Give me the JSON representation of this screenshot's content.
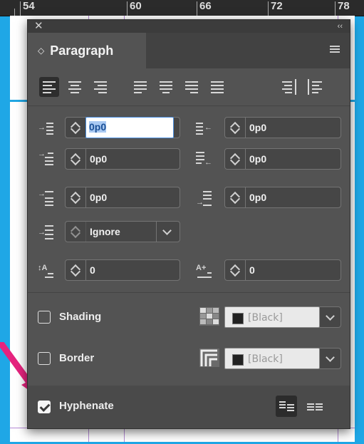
{
  "ruler": {
    "labels": [
      "54",
      "60",
      "66",
      "72",
      "78"
    ]
  },
  "panel": {
    "title": "Paragraph",
    "close_icon": "close-icon",
    "collapse_icon": "collapse-icon",
    "left_indent": "0p0",
    "right_indent": "0p0",
    "first_line_indent": "0p0",
    "last_line_indent": "0p0",
    "space_before": "0p0",
    "space_after": "0p0",
    "align_to_grid": "Ignore",
    "drop_cap_lines": "0",
    "drop_cap_chars": "0",
    "shading": {
      "label": "Shading",
      "checked": false,
      "color": "[Black]"
    },
    "border": {
      "label": "Border",
      "checked": false,
      "color": "[Black]"
    },
    "hyphenate": {
      "label": "Hyphenate",
      "checked": true
    }
  },
  "colors": {
    "highlight_arrow": "#e6237e",
    "panel_bg": "#535353",
    "canvas": "#1fa7e6"
  }
}
